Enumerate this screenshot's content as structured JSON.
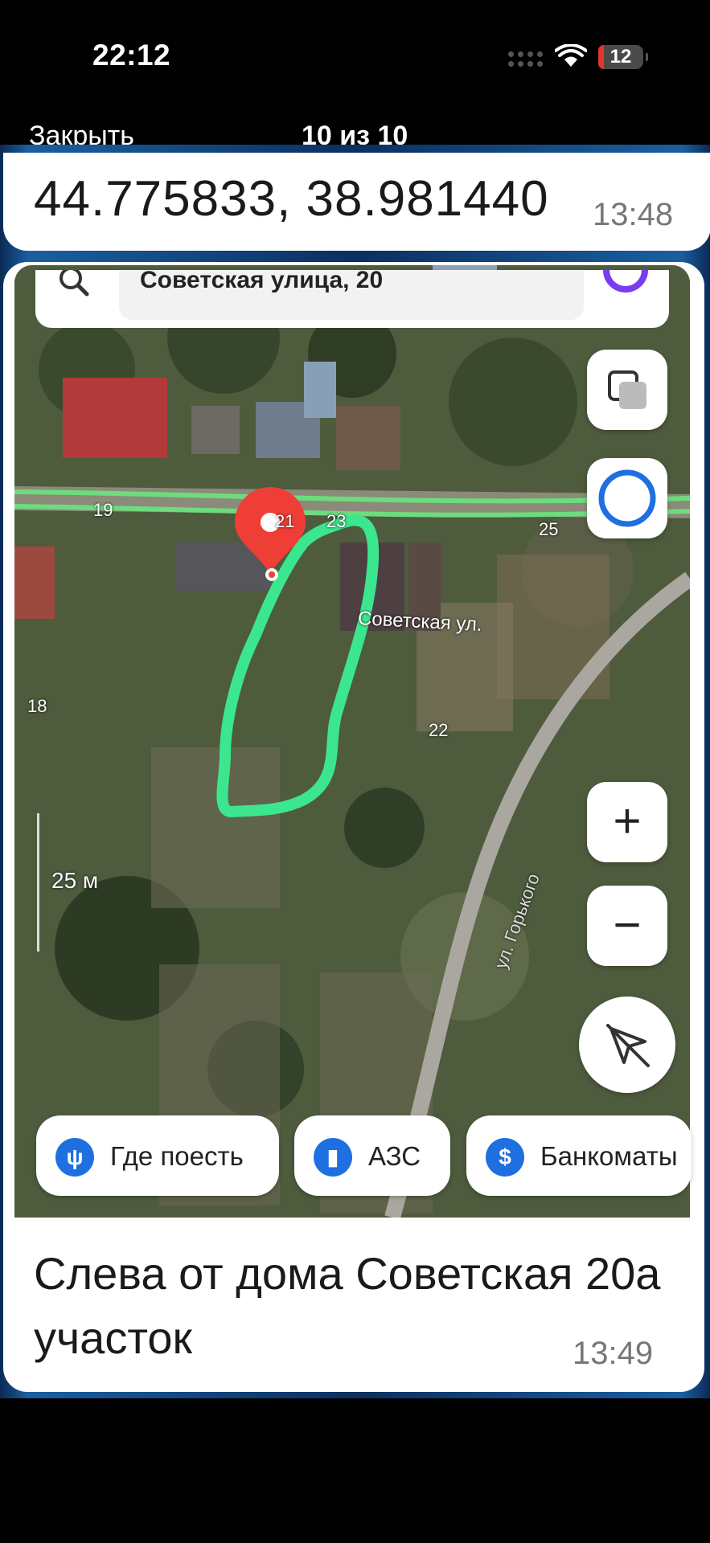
{
  "status_bar": {
    "time": "22:12",
    "battery": "12"
  },
  "viewer": {
    "close_label": "Закрыть",
    "counter": "10 из 10"
  },
  "message1": {
    "text": "44.775833, 38.981440",
    "time": "13:48"
  },
  "map": {
    "search_text": "Советская улица, 20",
    "house_numbers": {
      "n19": "19",
      "n21": "21",
      "n23": "23",
      "n25": "25",
      "n18": "18",
      "n22": "22"
    },
    "street_sovetskaya": "Советская ул.",
    "street_gorkogo": "ул. Горького",
    "scale": "25 м",
    "zoom_in": "+",
    "zoom_out": "−",
    "chips": [
      {
        "label": "Где поесть",
        "icon": "fork-knife-icon"
      },
      {
        "label": "АЗС",
        "icon": "fuel-icon"
      },
      {
        "label": "Банкоматы",
        "icon": "dollar-icon"
      }
    ]
  },
  "message2": {
    "text": "Слева от дома Советская 20а участок",
    "time": "13:49"
  },
  "colors": {
    "outline": "#3be68f",
    "pin": "#ef3e36",
    "chip_icon": "#1e6fe0"
  }
}
